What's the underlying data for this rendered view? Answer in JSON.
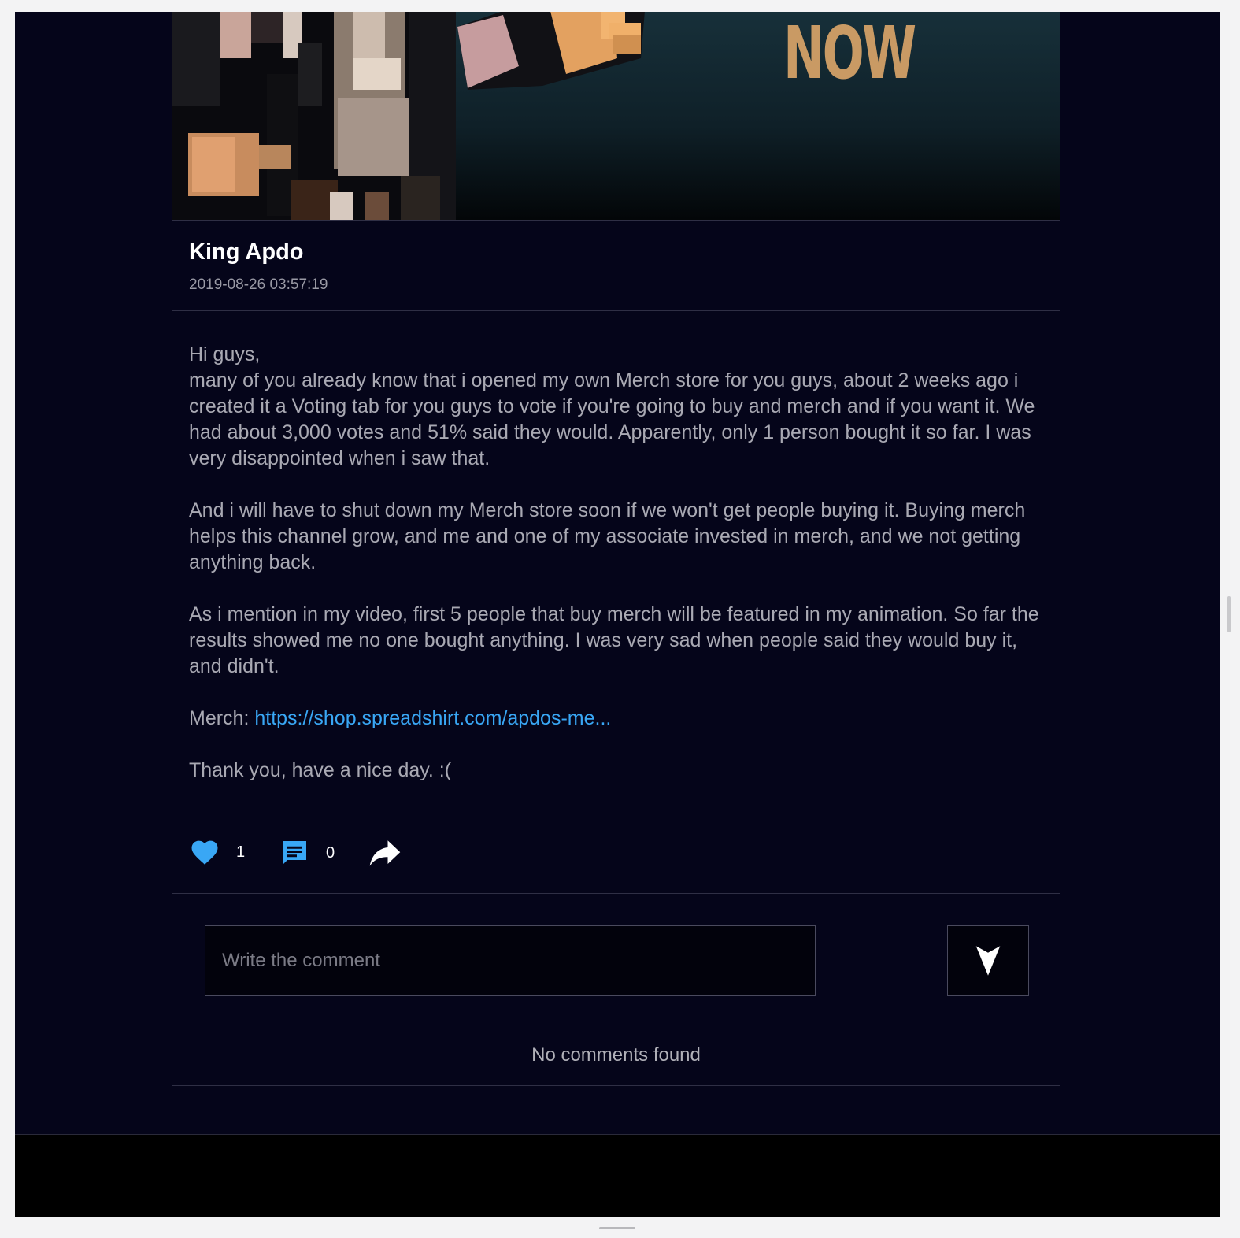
{
  "banner": {
    "word": "NOW"
  },
  "post": {
    "author": "King Apdo",
    "date": "2019-08-26 03:57:19",
    "paragraphs": [
      "Hi guys,\nmany of you already know that i opened my own Merch store for you guys, about 2 weeks ago i created it a Voting tab for you guys to vote if you're going to buy and merch and if you want it. We had about 3,000 votes and 51% said they would. Apparently, only 1 person bought it so far. I was very disappointed when i saw that.",
      "And i will have to shut down my Merch store soon if we won't get people buying it. Buying merch helps this channel grow, and me and one of my associate invested in merch, and we not getting anything back.",
      "As i mention in my video, first 5 people that buy merch will be featured in my animation. So far the results showed me no one bought anything. I was very sad when people said they would buy it, and didn't."
    ],
    "merch_label": "Merch: ",
    "merch_link": "https://shop.spreadshirt.com/apdos-me...",
    "closing": "Thank you, have a nice day. :("
  },
  "actions": {
    "likes": "1",
    "comments": "0",
    "like_icon": "heart-icon",
    "comment_icon": "comment-icon",
    "share_icon": "share-icon",
    "accent_color": "#39a7f5"
  },
  "comment_box": {
    "placeholder": "Write the comment",
    "value": "",
    "send_icon": "send-arrow-icon"
  },
  "comments": {
    "empty_text": "No comments found"
  },
  "colors": {
    "background": "#05051a",
    "footer": "#000000",
    "link": "#39a7f5"
  }
}
